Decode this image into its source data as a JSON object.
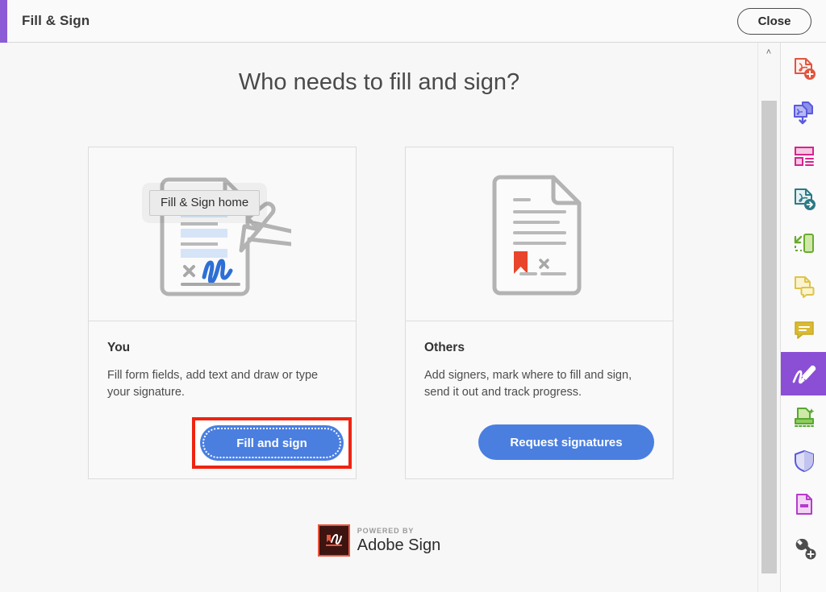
{
  "header": {
    "title": "Fill & Sign",
    "close_label": "Close",
    "accent_color": "#8b5cd6"
  },
  "main": {
    "heading": "Who needs to fill and sign?",
    "tooltip": "Fill & Sign home",
    "cards": [
      {
        "id": "you",
        "title": "You",
        "description": "Fill form fields, add text and draw or type your signature.",
        "button_label": "Fill and sign",
        "illustration": "document-pen-signature-illustration",
        "highlighted": true,
        "highlight_color": "#ee2411"
      },
      {
        "id": "others",
        "title": "Others",
        "description": "Add signers, mark where to fill and sign, send it out and track progress.",
        "button_label": "Request signatures",
        "illustration": "document-seal-signature-illustration",
        "highlighted": false
      }
    ],
    "button_color": "#4a7fe0"
  },
  "footer": {
    "powered_by": "POWERED BY",
    "brand": "Adobe Sign"
  },
  "scrollbar": {
    "up_arrow": "˄"
  },
  "toolbar": {
    "items": [
      {
        "name": "create-pdf-icon",
        "label": "Create PDF",
        "active": false
      },
      {
        "name": "combine-files-icon",
        "label": "Combine Files",
        "active": false
      },
      {
        "name": "organize-pages-icon",
        "label": "Organize Pages",
        "active": false
      },
      {
        "name": "export-pdf-icon",
        "label": "Export PDF",
        "active": false
      },
      {
        "name": "edit-pdf-icon",
        "label": "Edit PDF",
        "active": false
      },
      {
        "name": "comment-icon",
        "label": "Comment",
        "active": false
      },
      {
        "name": "sticky-note-icon",
        "label": "Add Comment",
        "active": false
      },
      {
        "name": "fill-and-sign-icon",
        "label": "Fill & Sign",
        "active": true
      },
      {
        "name": "send-for-signature-icon",
        "label": "Send for Signature",
        "active": false
      },
      {
        "name": "protect-shield-icon",
        "label": "Protect",
        "active": false
      },
      {
        "name": "redact-icon",
        "label": "Redact",
        "active": false
      },
      {
        "name": "more-tools-icon",
        "label": "More Tools",
        "active": false
      }
    ]
  }
}
